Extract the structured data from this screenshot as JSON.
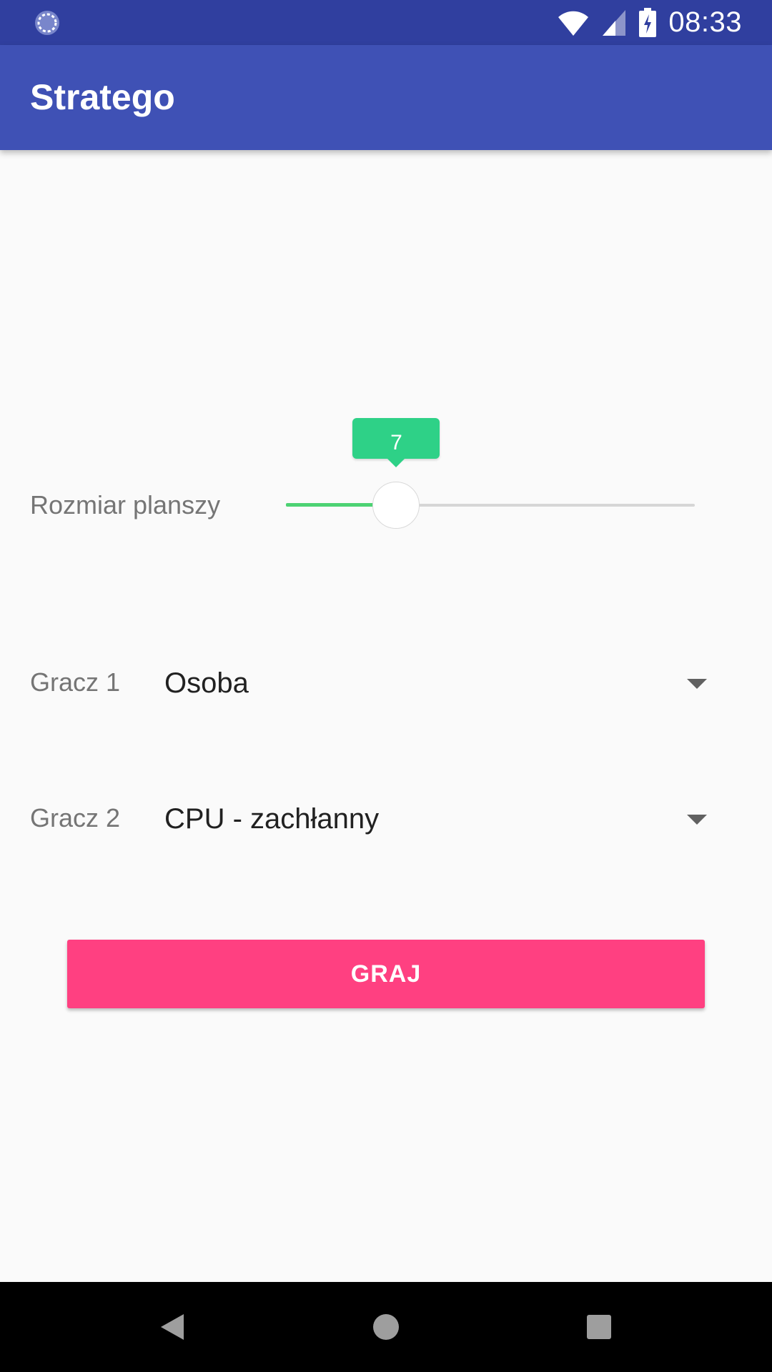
{
  "status_bar": {
    "time": "08:33",
    "left_icon": "sync-icon",
    "icons": [
      "wifi-icon",
      "cell-signal-icon",
      "battery-charging-icon"
    ],
    "background_color": "#303f9f"
  },
  "app_bar": {
    "title": "Stratego",
    "background_color": "#3f51b5"
  },
  "board_size": {
    "label": "Rozmiar planszy",
    "value": "7",
    "fraction": 0.27,
    "accent_color": "#2ed187"
  },
  "player1": {
    "label": "Gracz 1",
    "selected": "Osoba"
  },
  "player2": {
    "label": "Gracz 2",
    "selected": "CPU - zachłanny"
  },
  "play_button": {
    "label": "GRAJ",
    "color": "#ff4081"
  },
  "nav_bar": {
    "icons": [
      "back-icon",
      "home-icon",
      "recents-icon"
    ]
  }
}
